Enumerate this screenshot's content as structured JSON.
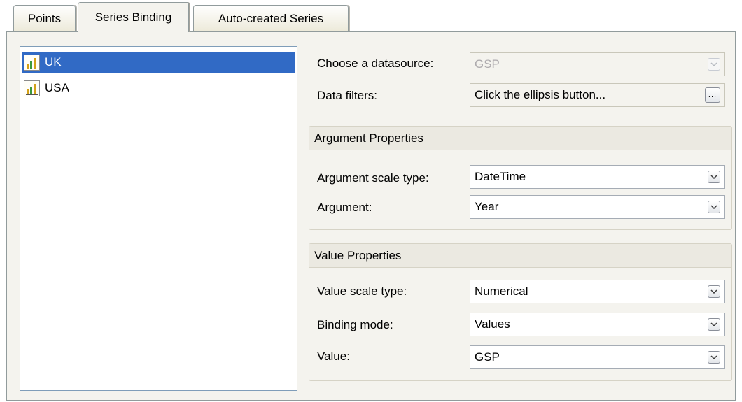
{
  "tabs": [
    {
      "label": "Points",
      "active": false
    },
    {
      "label": "Series Binding",
      "active": true
    },
    {
      "label": "Auto-created Series",
      "active": false
    }
  ],
  "series_list": [
    {
      "label": "UK",
      "selected": true,
      "icon": "bar-chart-icon"
    },
    {
      "label": "USA",
      "selected": false,
      "icon": "bar-chart-icon"
    }
  ],
  "datasource": {
    "label": "Choose a datasource:",
    "value": "GSP",
    "enabled": false
  },
  "data_filters": {
    "label": "Data filters:",
    "value": "Click the ellipsis button...",
    "button_label": "..."
  },
  "argument_group": {
    "title": "Argument Properties",
    "scale_type": {
      "label": "Argument scale type:",
      "value": "DateTime"
    },
    "argument": {
      "label": "Argument:",
      "value": "Year"
    }
  },
  "value_group": {
    "title": "Value Properties",
    "scale_type": {
      "label": "Value scale type:",
      "value": "Numerical"
    },
    "binding_mode": {
      "label": "Binding mode:",
      "value": "Values"
    },
    "value": {
      "label": "Value:",
      "value": "GSP"
    }
  },
  "colors": {
    "selection": "#316ac5",
    "panel_background": "#f4f3ee",
    "border": "#919b9c",
    "disabled_text": "#adaaad"
  }
}
